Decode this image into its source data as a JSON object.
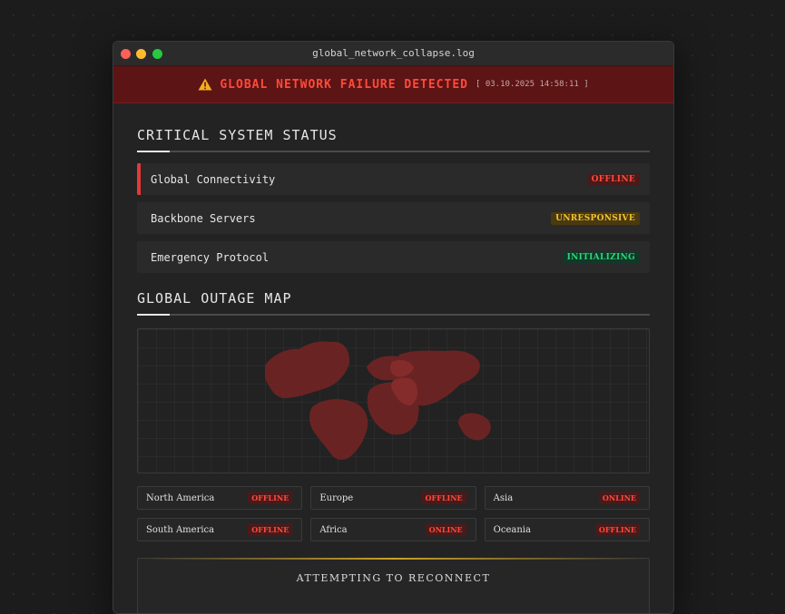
{
  "window": {
    "title": "global_network_collapse.log"
  },
  "alert": {
    "icon": "warning-triangle-icon",
    "text": "GLOBAL NETWORK FAILURE DETECTED",
    "timestamp": "[ 03.10.2025 14:58:11 ]",
    "color": "#ff4a3d"
  },
  "status_section": {
    "title": "CRITICAL SYSTEM STATUS",
    "items": [
      {
        "label": "Global Connectivity",
        "badge": "OFFLINE"
      },
      {
        "label": "Backbone Servers",
        "badge": "UNRESPONSIVE"
      },
      {
        "label": "Emergency Protocol",
        "badge": "INITIALIZING"
      }
    ]
  },
  "map_section": {
    "title": "GLOBAL OUTAGE MAP",
    "regions": [
      {
        "name": "North America",
        "status": "OFFLINE"
      },
      {
        "name": "Europe",
        "status": "OFFLINE"
      },
      {
        "name": "Asia",
        "status": "ONLINE"
      },
      {
        "name": "South America",
        "status": "OFFLINE"
      },
      {
        "name": "Africa",
        "status": "ONLINE"
      },
      {
        "name": "Oceania",
        "status": "OFFLINE"
      }
    ]
  },
  "reconnect": {
    "text": "ATTEMPTING TO RECONNECT"
  },
  "colors": {
    "offline": "#ff4a3d",
    "unresponsive": "#f2c230",
    "initializing": "#2ed573",
    "map_land": "#6e2424"
  }
}
